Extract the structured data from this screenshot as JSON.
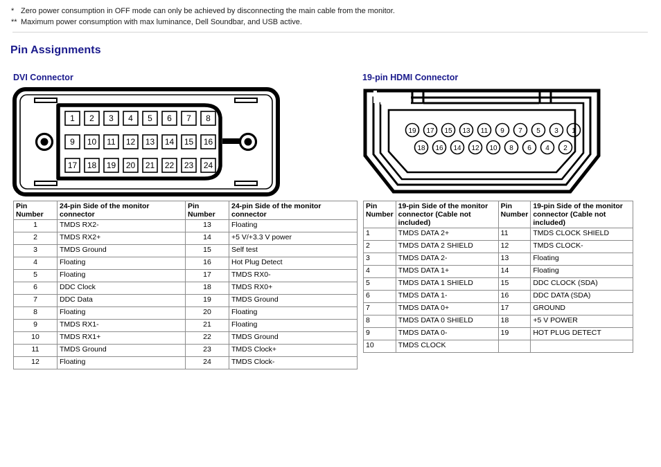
{
  "footnotes": [
    {
      "mark": "*",
      "text": "Zero power consumption in OFF mode can only be achieved by disconnecting the main cable from the monitor."
    },
    {
      "mark": "**",
      "text": "Maximum power consumption with max luminance, Dell Soundbar, and USB active."
    }
  ],
  "page_title": "Pin Assignments",
  "colors": {
    "heading": "#1a1a8c",
    "table_border": "#8c8c8c",
    "divider": "#d4d4d4",
    "diagram_stroke": "#000000"
  },
  "dvi": {
    "section_title": "DVI Connector",
    "diagram": {
      "name": "dvi-connector-diagram",
      "pin_rows": [
        [
          "1",
          "2",
          "3",
          "4",
          "5",
          "6",
          "7",
          "8"
        ],
        [
          "9",
          "10",
          "11",
          "12",
          "13",
          "14",
          "15",
          "16"
        ],
        [
          "17",
          "18",
          "19",
          "20",
          "21",
          "22",
          "23",
          "24"
        ]
      ]
    },
    "headers": [
      "Pin Number",
      "24-pin Side of the monitor connector",
      "Pin Number",
      "24-pin Side of the monitor connector"
    ],
    "rows": [
      [
        "1",
        "TMDS RX2-",
        "13",
        "Floating"
      ],
      [
        "2",
        "TMDS RX2+",
        "14",
        "+5 V/+3.3 V power"
      ],
      [
        "3",
        "TMDS Ground",
        "15",
        "Self test"
      ],
      [
        "4",
        "Floating",
        "16",
        "Hot Plug Detect"
      ],
      [
        "5",
        "Floating",
        "17",
        "TMDS RX0-"
      ],
      [
        "6",
        "DDC Clock",
        "18",
        "TMDS RX0+"
      ],
      [
        "7",
        "DDC Data",
        "19",
        "TMDS Ground"
      ],
      [
        "8",
        "Floating",
        "20",
        "Floating"
      ],
      [
        "9",
        "TMDS RX1-",
        "21",
        "Floating"
      ],
      [
        "10",
        "TMDS RX1+",
        "22",
        "TMDS Ground"
      ],
      [
        "11",
        "TMDS Ground",
        "23",
        "TMDS Clock+"
      ],
      [
        "12",
        "Floating",
        "24",
        "TMDS Clock-"
      ]
    ]
  },
  "hdmi": {
    "section_title": "19-pin HDMI Connector",
    "diagram": {
      "name": "hdmi-connector-diagram",
      "pin_rows": [
        [
          "19",
          "17",
          "15",
          "13",
          "11",
          "9",
          "7",
          "5",
          "3",
          "1"
        ],
        [
          "18",
          "16",
          "14",
          "12",
          "10",
          "8",
          "6",
          "4",
          "2"
        ]
      ]
    },
    "headers": [
      "Pin Number",
      "19-pin Side of the monitor connector (Cable not included)",
      "Pin Number",
      "19-pin Side of the monitor connector (Cable not included)"
    ],
    "rows": [
      [
        "1",
        "TMDS DATA 2+",
        "11",
        "TMDS CLOCK SHIELD"
      ],
      [
        "2",
        "TMDS DATA 2 SHIELD",
        "12",
        "TMDS CLOCK-"
      ],
      [
        "3",
        "TMDS DATA 2-",
        "13",
        "Floating"
      ],
      [
        "4",
        "TMDS DATA 1+",
        "14",
        "Floating"
      ],
      [
        "5",
        "TMDS DATA 1 SHIELD",
        "15",
        "DDC CLOCK (SDA)"
      ],
      [
        "6",
        "TMDS DATA 1-",
        "16",
        "DDC DATA (SDA)"
      ],
      [
        "7",
        "TMDS DATA 0+",
        "17",
        "GROUND"
      ],
      [
        "8",
        "TMDS DATA 0 SHIELD",
        "18",
        "+5 V POWER"
      ],
      [
        "9",
        "TMDS DATA 0-",
        "19",
        "HOT PLUG DETECT"
      ],
      [
        "10",
        "TMDS CLOCK",
        "",
        ""
      ]
    ]
  }
}
